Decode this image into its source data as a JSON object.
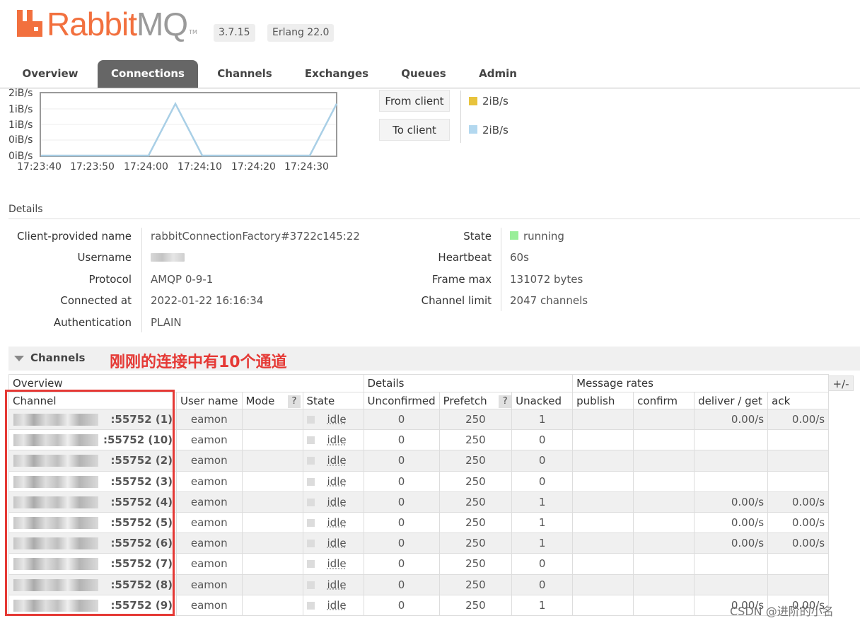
{
  "header": {
    "brand_prefix": "Rabbit",
    "brand_suffix": "MQ",
    "trademark": "TM",
    "version": "3.7.15",
    "erlang": "Erlang 22.0"
  },
  "tabs": [
    {
      "label": "Overview",
      "active": false
    },
    {
      "label": "Connections",
      "active": true
    },
    {
      "label": "Channels",
      "active": false
    },
    {
      "label": "Exchanges",
      "active": false
    },
    {
      "label": "Queues",
      "active": false
    },
    {
      "label": "Admin",
      "active": false
    }
  ],
  "chart_data": {
    "type": "line",
    "y_tick_labels": [
      "2iB/s",
      "1iB/s",
      "1iB/s",
      "0iB/s",
      "0iB/s"
    ],
    "x_tick_labels": [
      "17:23:40",
      "17:23:50",
      "17:24:00",
      "17:24:10",
      "17:24:20",
      "17:24:30"
    ],
    "x": [
      "17:23:40",
      "17:23:45",
      "17:23:50",
      "17:23:55",
      "17:24:00",
      "17:24:05",
      "17:24:10",
      "17:24:15",
      "17:24:20",
      "17:24:25",
      "17:24:30",
      "17:24:35"
    ],
    "series": [
      {
        "name": "To client",
        "color": "#a9cfe6",
        "values": [
          0,
          0,
          0,
          0,
          0,
          2,
          0,
          0,
          0,
          0,
          0,
          2
        ]
      }
    ],
    "ylim": [
      0,
      2.4
    ]
  },
  "legend": {
    "from_client": {
      "label": "From client",
      "value": "2iB/s",
      "color": "#e8c33c"
    },
    "to_client": {
      "label": "To client",
      "value": "2iB/s",
      "color": "#b3d8ef"
    }
  },
  "details": {
    "title": "Details",
    "left": [
      {
        "key": "Client-provided name",
        "value": "rabbitConnectionFactory#3722c145:22"
      },
      {
        "key": "Username",
        "value": ""
      },
      {
        "key": "Protocol",
        "value": "AMQP 0-9-1"
      },
      {
        "key": "Connected at",
        "value": "2022-01-22 16:16:34"
      },
      {
        "key": "Authentication",
        "value": "PLAIN"
      }
    ],
    "right": [
      {
        "key": "State",
        "value": "running",
        "color": "#99ee99"
      },
      {
        "key": "Heartbeat",
        "value": "60s"
      },
      {
        "key": "Frame max",
        "value": "131072 bytes"
      },
      {
        "key": "Channel limit",
        "value": "2047 channels"
      }
    ]
  },
  "channels_section": {
    "title": "Channels",
    "annotation": "刚刚的连接中有10个通道",
    "toggle_label": "+/-",
    "groups": [
      "Overview",
      "Details",
      "Message rates"
    ],
    "columns": [
      "Channel",
      "User name",
      "Mode",
      "?",
      "State",
      "Unconfirmed",
      "Prefetch",
      "?",
      "Unacked",
      "publish",
      "confirm",
      "deliver / get",
      "ack"
    ],
    "rows": [
      {
        "channel": ":55752 (1)",
        "user": "eamon",
        "state": "idle",
        "unconfirmed": "0",
        "prefetch": "250",
        "unacked": "1",
        "publish": "",
        "confirm": "",
        "deliver": "0.00/s",
        "ack": "0.00/s"
      },
      {
        "channel": ":55752 (10)",
        "user": "eamon",
        "state": "idle",
        "unconfirmed": "0",
        "prefetch": "250",
        "unacked": "0",
        "publish": "",
        "confirm": "",
        "deliver": "",
        "ack": ""
      },
      {
        "channel": ":55752 (2)",
        "user": "eamon",
        "state": "idle",
        "unconfirmed": "0",
        "prefetch": "250",
        "unacked": "0",
        "publish": "",
        "confirm": "",
        "deliver": "",
        "ack": ""
      },
      {
        "channel": ":55752 (3)",
        "user": "eamon",
        "state": "idle",
        "unconfirmed": "0",
        "prefetch": "250",
        "unacked": "0",
        "publish": "",
        "confirm": "",
        "deliver": "",
        "ack": ""
      },
      {
        "channel": ":55752 (4)",
        "user": "eamon",
        "state": "idle",
        "unconfirmed": "0",
        "prefetch": "250",
        "unacked": "1",
        "publish": "",
        "confirm": "",
        "deliver": "0.00/s",
        "ack": "0.00/s"
      },
      {
        "channel": ":55752 (5)",
        "user": "eamon",
        "state": "idle",
        "unconfirmed": "0",
        "prefetch": "250",
        "unacked": "1",
        "publish": "",
        "confirm": "",
        "deliver": "0.00/s",
        "ack": "0.00/s"
      },
      {
        "channel": ":55752 (6)",
        "user": "eamon",
        "state": "idle",
        "unconfirmed": "0",
        "prefetch": "250",
        "unacked": "1",
        "publish": "",
        "confirm": "",
        "deliver": "0.00/s",
        "ack": "0.00/s"
      },
      {
        "channel": ":55752 (7)",
        "user": "eamon",
        "state": "idle",
        "unconfirmed": "0",
        "prefetch": "250",
        "unacked": "0",
        "publish": "",
        "confirm": "",
        "deliver": "",
        "ack": ""
      },
      {
        "channel": ":55752 (8)",
        "user": "eamon",
        "state": "idle",
        "unconfirmed": "0",
        "prefetch": "250",
        "unacked": "0",
        "publish": "",
        "confirm": "",
        "deliver": "",
        "ack": ""
      },
      {
        "channel": ":55752 (9)",
        "user": "eamon",
        "state": "idle",
        "unconfirmed": "0",
        "prefetch": "250",
        "unacked": "1",
        "publish": "",
        "confirm": "",
        "deliver": "0.00/s",
        "ack": "0.00/s"
      }
    ]
  },
  "watermark": "CSDN @进阶的小名"
}
